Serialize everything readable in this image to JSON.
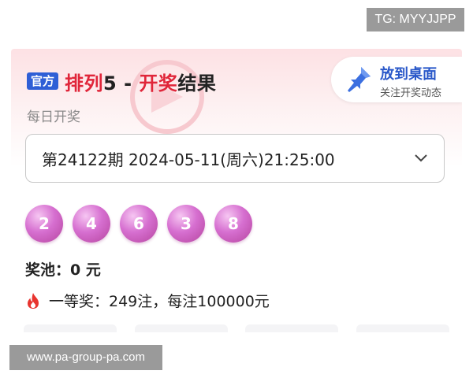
{
  "overlay": {
    "tg_label": "TG: MYYJJPP",
    "url_label": "www.pa-group-pa.com"
  },
  "header": {
    "official_badge": "官方",
    "title_part1": "排列",
    "title_part2": "5 - ",
    "title_part3": "开奖",
    "title_part4": "结果",
    "subtitle": "每日开奖"
  },
  "desktop_button": {
    "title": "放到桌面",
    "subtitle": "关注开奖动态",
    "icon": "pin-icon"
  },
  "period_select": {
    "value": "第24122期 2024-05-11(周六)21:25:00",
    "icon": "chevron-down-icon"
  },
  "balls": [
    "2",
    "4",
    "6",
    "3",
    "8"
  ],
  "pool": {
    "text": "奖池：0 元"
  },
  "prize": {
    "icon": "fire-icon",
    "text": "一等奖：249注，每注100000元"
  },
  "colors": {
    "accent_red": "#e0263a",
    "badge_blue": "#2f5fd6",
    "ball_purple": "#c95bc0"
  }
}
